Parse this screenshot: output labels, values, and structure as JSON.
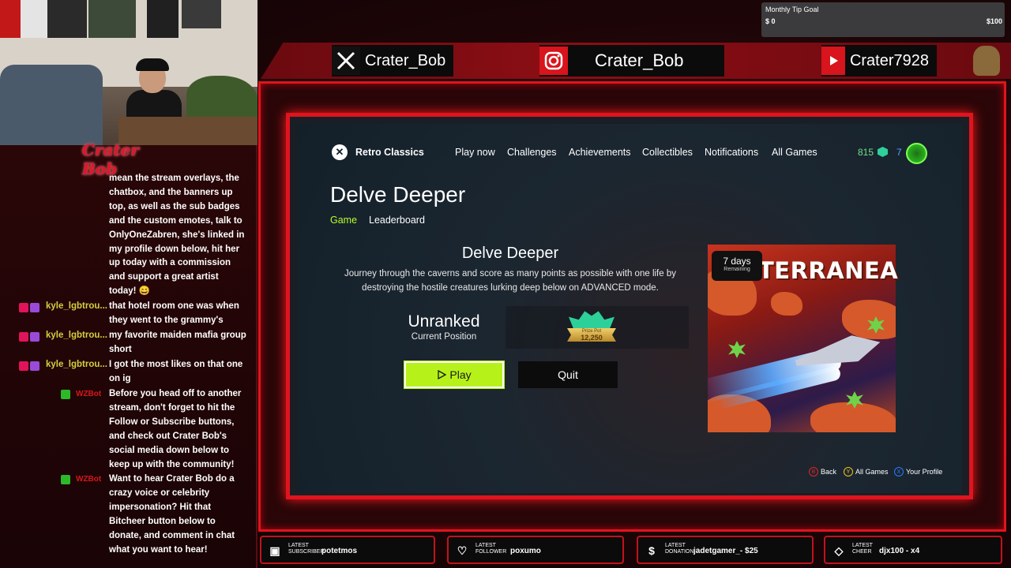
{
  "goal": {
    "title": "Monthly Tip Goal",
    "min": "$ 0",
    "max": "$100",
    "progress": 0
  },
  "social": [
    {
      "icon": "x-icon",
      "name": "Crater_Bob"
    },
    {
      "icon": "instagram-icon",
      "name": "Crater_Bob"
    },
    {
      "icon": "youtube-icon",
      "name": "Crater7928"
    }
  ],
  "chat": {
    "logo": "Crater Bob",
    "messages": [
      {
        "user": "",
        "text": "mean the stream overlays, the chatbox, and the banners up top, as well as the sub badges and the custom emotes, talk to OnlyOneZabren, she's linked in my profile down below, hit her up today with a commission and support a great artist today! 😄"
      },
      {
        "user": "kyle_lgbtrou...",
        "text": "that hotel room one was when they went to the grammy's"
      },
      {
        "user": "kyle_lgbtrou...",
        "text": "my favorite maiden mafia group short"
      },
      {
        "user": "kyle_lgbtrou...",
        "text": "I got the most likes on that one on ig"
      },
      {
        "user": "WZBot",
        "text": "Before you head off to another stream, don't forget to hit the Follow or Subscribe buttons, and check out Crater Bob's social media down below to keep up with the community!"
      },
      {
        "user": "WZBot",
        "text": "Want to hear Crater Bob do a crazy voice or celebrity impersonation? Hit that Bitcheer button below to donate, and comment in chat what you want to hear!"
      }
    ]
  },
  "xbox": {
    "brand": "Retro Classics",
    "nav": [
      "Play now",
      "Challenges",
      "Achievements",
      "Collectibles",
      "Notifications",
      "All Games"
    ],
    "score": "815",
    "level": "7",
    "title": "Delve Deeper",
    "tabs": [
      "Game",
      "Leaderboard"
    ],
    "card_title": "Delve Deeper",
    "description": "Journey through the caverns and score as many points as possible with one life by destroying the hostile creatures lurking deep below on ADVANCED mode.",
    "position_value": "Unranked",
    "position_label": "Current Position",
    "prize_label": "Prize Pot",
    "prize_amount": "12,250",
    "play_label": "Play",
    "quit_label": "Quit",
    "days": "7 days",
    "days_sub": "Remaining",
    "art_word": "TERRANEA",
    "hints": [
      {
        "key": "B",
        "label": "Back",
        "color": "#e0242a"
      },
      {
        "key": "Y",
        "label": "All Games",
        "color": "#f2c21a"
      },
      {
        "key": "X",
        "label": "Your Profile",
        "color": "#2a7cff"
      }
    ]
  },
  "events": [
    {
      "type": "LATEST SUBSCRIBER",
      "l1": "LATEST",
      "l2": "SUBSCRIBER",
      "value": "potetmos"
    },
    {
      "type": "LATEST FOLLOWER",
      "l1": "LATEST",
      "l2": "FOLLOWER",
      "value": "poxumo"
    },
    {
      "type": "LATEST DONATION",
      "l1": "LATEST",
      "l2": "DONATION",
      "value": "jadetgamer_- $25"
    },
    {
      "type": "LATEST CHEER",
      "l1": "LATEST",
      "l2": "CHEER",
      "value": "djx100 - x4"
    }
  ]
}
